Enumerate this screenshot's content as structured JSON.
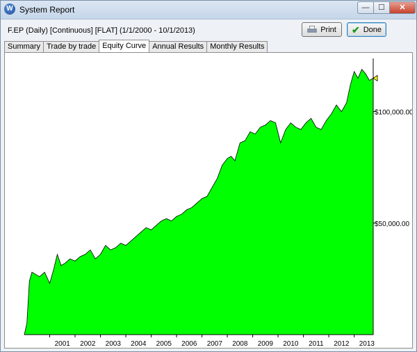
{
  "window": {
    "title": "System Report"
  },
  "report": {
    "header": "F.EP (Daily) [Continuous] [FLAT]  (1/1/2000 - 10/1/2013)"
  },
  "buttons": {
    "print": "Print",
    "done": "Done"
  },
  "window_controls": {
    "minimize": "—",
    "maximize": "☐",
    "close": "✕"
  },
  "tabs": [
    "Summary",
    "Trade by trade",
    "Equity Curve",
    "Annual Results",
    "Monthly Results"
  ],
  "active_tab": "Equity Curve",
  "colors": {
    "fill": "#00ff00",
    "stroke": "#000000",
    "background": "#ffffff",
    "marker": "#ffff00"
  },
  "icons": {
    "app": "W",
    "done": "check-icon",
    "print": "printer-icon"
  },
  "chart_data": {
    "type": "area",
    "title": "",
    "xlabel": "",
    "ylabel": "",
    "x_ticks": [
      "2001",
      "2002",
      "2003",
      "2004",
      "2005",
      "2006",
      "2007",
      "2008",
      "2009",
      "2010",
      "2011",
      "2012",
      "2013"
    ],
    "y_ticks": [
      "$50,000.00",
      "$100,000.00"
    ],
    "ylim": [
      0,
      122000
    ],
    "xlim": [
      2000.0,
      2013.75
    ],
    "y_axis_side": "right",
    "grid": false,
    "series": [
      {
        "x": [
          2000.0,
          2000.1,
          2000.2,
          2000.3,
          2000.45,
          2000.6,
          2000.8,
          2001.0,
          2001.15,
          2001.3,
          2001.45,
          2001.6,
          2001.8,
          2002.0,
          2002.2,
          2002.4,
          2002.6,
          2002.8,
          2003.0,
          2003.2,
          2003.4,
          2003.6,
          2003.8,
          2004.0,
          2004.2,
          2004.4,
          2004.6,
          2004.8,
          2005.0,
          2005.2,
          2005.4,
          2005.6,
          2005.8,
          2006.0,
          2006.2,
          2006.4,
          2006.6,
          2006.8,
          2007.0,
          2007.2,
          2007.4,
          2007.6,
          2007.8,
          2008.0,
          2008.15,
          2008.3,
          2008.5,
          2008.7,
          2008.9,
          2009.1,
          2009.3,
          2009.5,
          2009.7,
          2009.9,
          2010.1,
          2010.3,
          2010.5,
          2010.7,
          2010.9,
          2011.1,
          2011.3,
          2011.5,
          2011.7,
          2011.9,
          2012.1,
          2012.3,
          2012.5,
          2012.7,
          2012.85,
          2013.0,
          2013.15,
          2013.3,
          2013.45,
          2013.6,
          2013.75
        ],
        "y": [
          0,
          5000,
          24000,
          28000,
          27000,
          26000,
          28000,
          23000,
          29000,
          36000,
          31000,
          32000,
          34000,
          33000,
          35000,
          36000,
          38000,
          34000,
          36000,
          40000,
          38000,
          39000,
          41000,
          40000,
          42000,
          44000,
          46000,
          48000,
          47000,
          49000,
          51000,
          52000,
          51000,
          53000,
          54000,
          56000,
          57000,
          59000,
          61000,
          62000,
          66000,
          70000,
          76000,
          79000,
          80000,
          78000,
          86000,
          87000,
          91000,
          90000,
          93000,
          94000,
          96000,
          95000,
          86000,
          92000,
          95000,
          93000,
          92000,
          95000,
          97000,
          93000,
          92000,
          96000,
          99000,
          103000,
          100000,
          104000,
          112000,
          118000,
          115000,
          119000,
          117000,
          114000,
          115000
        ]
      }
    ]
  }
}
